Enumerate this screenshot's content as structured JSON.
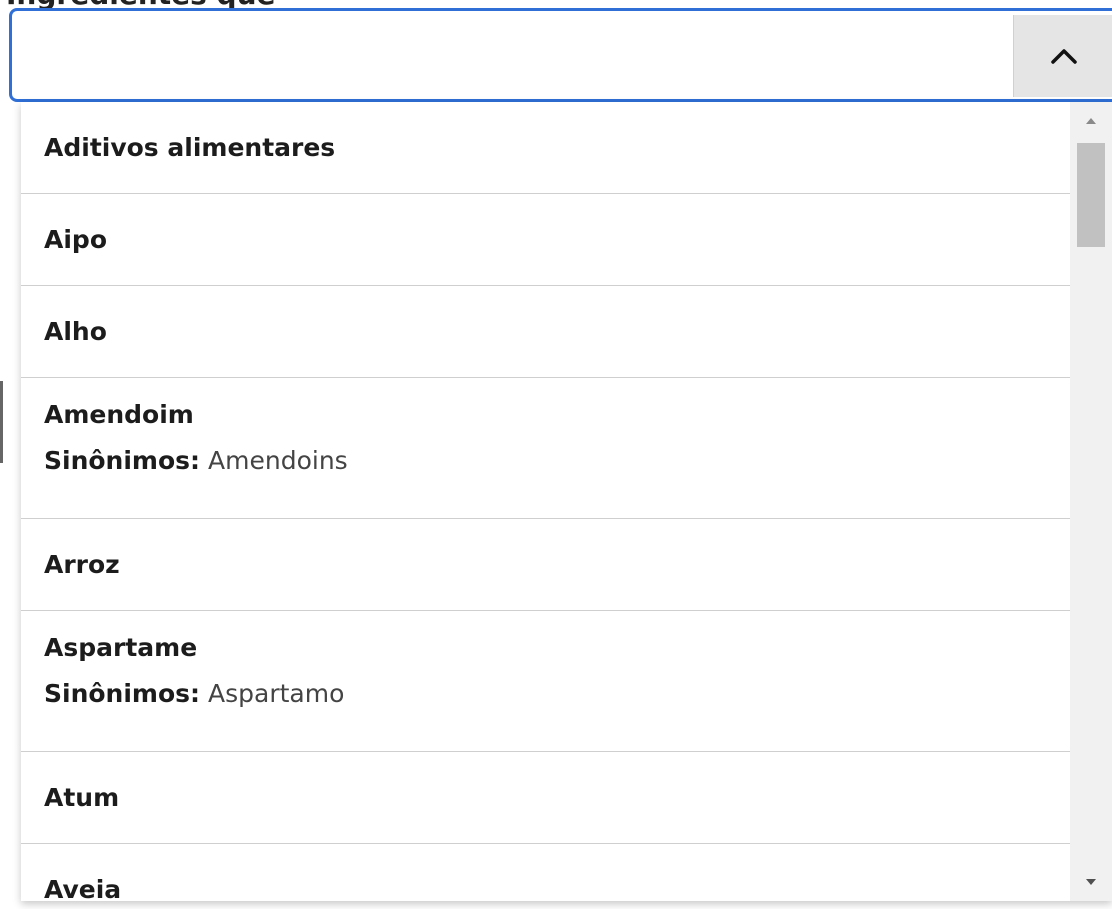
{
  "combobox": {
    "label": "Ingredientes que",
    "value": "",
    "toggle_icon": "chevron-up-icon"
  },
  "options": [
    {
      "name": "Aditivos alimentares"
    },
    {
      "name": "Aipo"
    },
    {
      "name": "Alho"
    },
    {
      "name": "Amendoim",
      "synonyms_label": "Sinônimos:",
      "synonyms": "Amendoins"
    },
    {
      "name": "Arroz"
    },
    {
      "name": "Aspartame",
      "synonyms_label": "Sinônimos:",
      "synonyms": "Aspartamo"
    },
    {
      "name": "Atum"
    },
    {
      "name": "Aveia"
    }
  ],
  "colors": {
    "focus_border": "#2f6fd6",
    "toggle_bg": "#e5e5e5",
    "divider": "#cfcfcf",
    "scroll_thumb": "#c1c1c1"
  }
}
